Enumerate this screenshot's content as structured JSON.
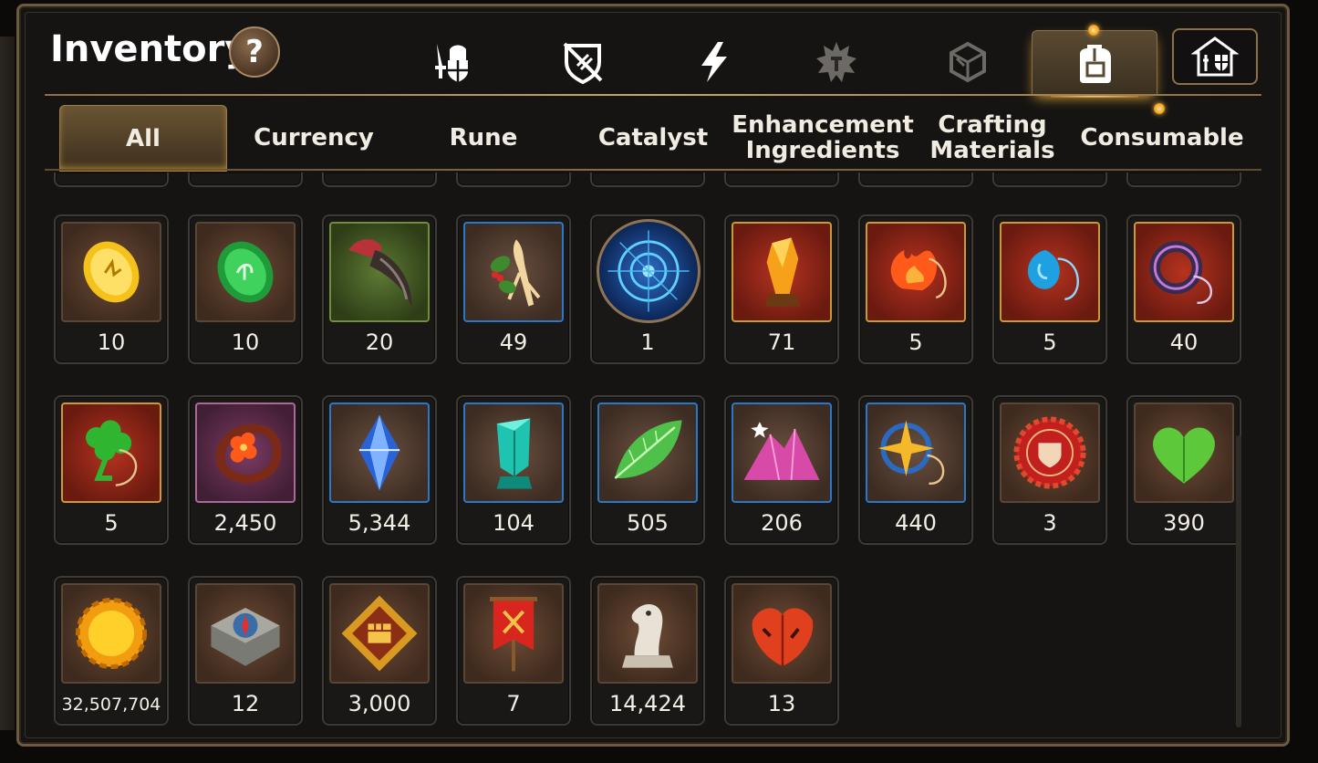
{
  "title": "Inventory",
  "help_label": "?",
  "top_tabs": [
    {
      "icon": "knight-shield-icon",
      "active": false
    },
    {
      "icon": "broken-shield-icon",
      "active": false
    },
    {
      "icon": "lightning-icon",
      "active": false
    },
    {
      "icon": "spiky-gear-icon",
      "active": false
    },
    {
      "icon": "dice-icon",
      "active": false
    },
    {
      "icon": "backpack-icon",
      "active": true
    }
  ],
  "shop_icon": "shop-icon",
  "sub_tabs": [
    {
      "label": "All",
      "active": true
    },
    {
      "label": "Currency",
      "active": false
    },
    {
      "label": "Rune",
      "active": false
    },
    {
      "label": "Catalyst",
      "active": false
    },
    {
      "label": "Enhancement\nIngredients",
      "active": false
    },
    {
      "label": "Crafting\nMaterials",
      "active": false
    },
    {
      "label": "Consumable",
      "active": false
    }
  ],
  "items": [
    {
      "icon": "gold-stone-icon",
      "count": "10",
      "frame": "brown"
    },
    {
      "icon": "green-rune-stone-icon",
      "count": "10",
      "frame": "brown"
    },
    {
      "icon": "claw-icon",
      "count": "20",
      "frame": "green"
    },
    {
      "icon": "ginseng-root-icon",
      "count": "49",
      "frame": "blue"
    },
    {
      "icon": "blue-rune-disc-icon",
      "count": "1",
      "frame": "circle"
    },
    {
      "icon": "amber-crystal-icon",
      "count": "71",
      "frame": "red"
    },
    {
      "icon": "fire-amulet-icon",
      "count": "5",
      "frame": "red"
    },
    {
      "icon": "water-amulet-icon",
      "count": "5",
      "frame": "red"
    },
    {
      "icon": "ring-amulet-icon",
      "count": "40",
      "frame": "red"
    },
    {
      "icon": "clover-amulet-icon",
      "count": "5",
      "frame": "red"
    },
    {
      "icon": "flower-ring-icon",
      "count": "2,450",
      "frame": "purple"
    },
    {
      "icon": "blue-diamond-icon",
      "count": "5,344",
      "frame": "blue"
    },
    {
      "icon": "teal-crystal-icon",
      "count": "104",
      "frame": "blue"
    },
    {
      "icon": "green-leaf-icon",
      "count": "505",
      "frame": "blue"
    },
    {
      "icon": "pink-crystal-pile-icon",
      "count": "206",
      "frame": "blue"
    },
    {
      "icon": "star-amulet-icon",
      "count": "440",
      "frame": "blue"
    },
    {
      "icon": "red-seal-icon",
      "count": "3",
      "frame": "brown"
    },
    {
      "icon": "green-heart-icon",
      "count": "390",
      "frame": "brown"
    },
    {
      "icon": "gold-coin-icon",
      "count": "32,507,704",
      "frame": "brown"
    },
    {
      "icon": "compass-stone-icon",
      "count": "12",
      "frame": "brown"
    },
    {
      "icon": "fist-emblem-icon",
      "count": "3,000",
      "frame": "brown"
    },
    {
      "icon": "war-banner-icon",
      "count": "7",
      "frame": "brown"
    },
    {
      "icon": "chess-knight-icon",
      "count": "14,424",
      "frame": "brown"
    },
    {
      "icon": "autumn-leaf-icon",
      "count": "13",
      "frame": "brown"
    }
  ]
}
